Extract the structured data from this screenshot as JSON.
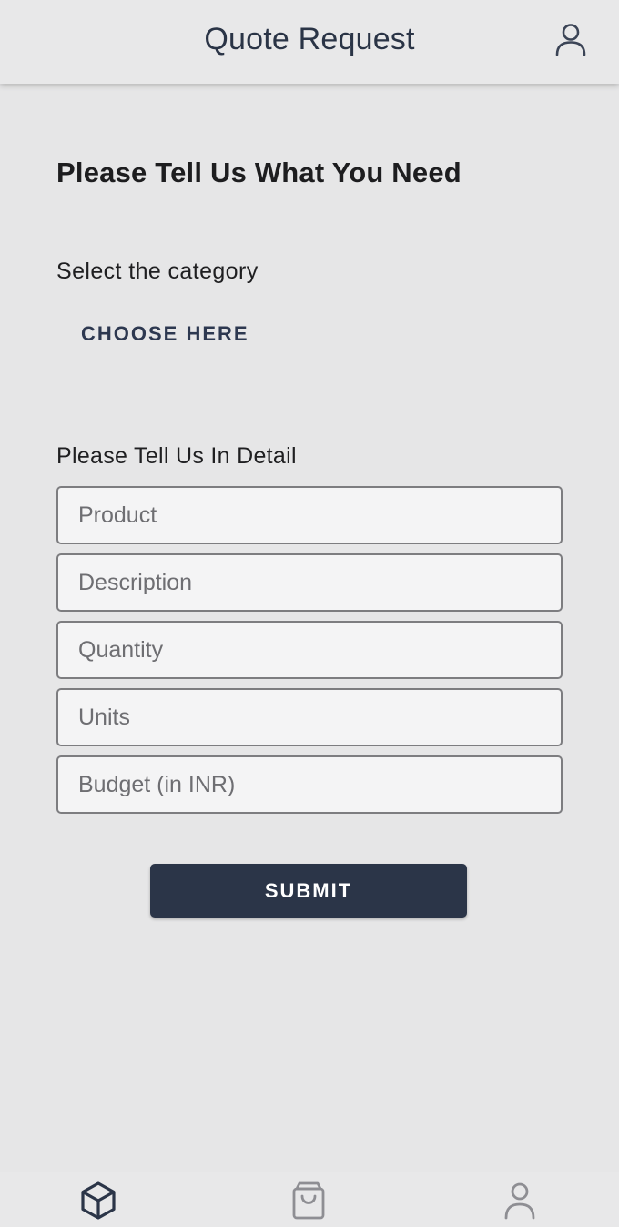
{
  "header": {
    "title": "Quote Request",
    "user_icon": "user-icon"
  },
  "form": {
    "heading": "Please Tell Us What You Need",
    "category_label": "Select the category",
    "category_button": "CHOOSE HERE",
    "detail_label": "Please Tell Us In Detail",
    "fields": {
      "product": {
        "placeholder": "Product",
        "value": ""
      },
      "description": {
        "placeholder": "Description",
        "value": ""
      },
      "quantity": {
        "placeholder": "Quantity",
        "value": ""
      },
      "units": {
        "placeholder": "Units",
        "value": ""
      },
      "budget": {
        "placeholder": "Budget (in INR)",
        "value": ""
      }
    },
    "submit_label": "SUBMIT"
  },
  "tabbar": {
    "tabs": [
      {
        "icon": "cube-icon",
        "active": true
      },
      {
        "icon": "shopping-bag-icon",
        "active": false
      },
      {
        "icon": "user-icon",
        "active": false
      }
    ]
  },
  "colors": {
    "primary": "#2b3548",
    "background": "#e6e6e7",
    "inactive_icon": "#8e8e93"
  }
}
